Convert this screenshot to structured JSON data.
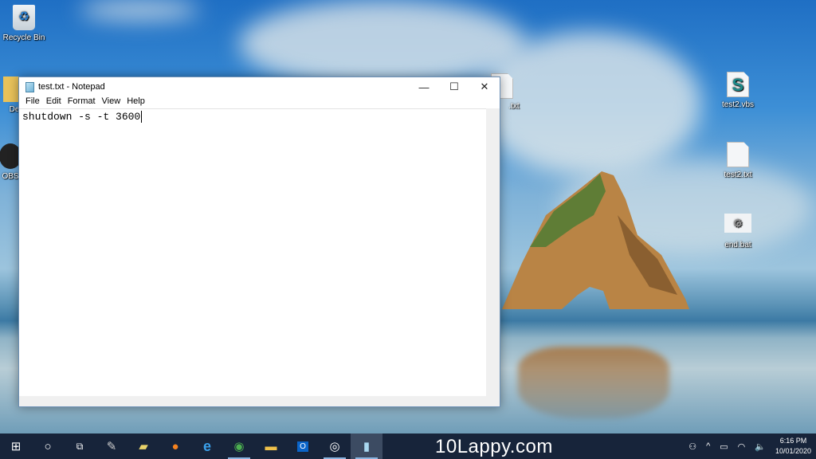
{
  "desktop": {
    "icons": [
      {
        "label": "Recycle Bin",
        "icon": "recycle-bin-icon"
      },
      {
        "label": "De",
        "icon": "folder-icon"
      },
      {
        "label": "OBS",
        "icon": "obs-icon"
      },
      {
        "label": ".txt",
        "icon": "text-file-icon"
      },
      {
        "label": "test2.vbs",
        "icon": "vbs-script-icon"
      },
      {
        "label": "test2.txt",
        "icon": "text-file-icon"
      },
      {
        "label": "end.bat",
        "icon": "batch-file-icon"
      }
    ]
  },
  "notepad": {
    "title": "test.txt - Notepad",
    "menu": [
      "File",
      "Edit",
      "Format",
      "View",
      "Help"
    ],
    "content": "shutdown -s -t 3600",
    "controls": {
      "minimize": "—",
      "maximize": "☐",
      "close": "✕"
    }
  },
  "taskbar": {
    "brand": "10Lappy.com",
    "time": "6:16 PM",
    "date": "10/01/2020",
    "apps": [
      "start",
      "search",
      "task-view",
      "app",
      "sticky",
      "firefox",
      "edge",
      "chrome",
      "file-explorer",
      "outlook",
      "obs",
      "notepad"
    ]
  },
  "colors": {
    "taskbar": "#17243a",
    "accent": "#8ab4e0"
  }
}
